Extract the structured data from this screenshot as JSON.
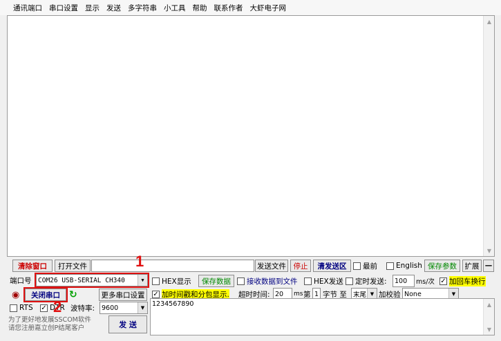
{
  "menu": [
    "通讯端口",
    "串口设置",
    "显示",
    "发送",
    "多字符串",
    "小工具",
    "帮助",
    "联系作者",
    "大虾电子网"
  ],
  "toolbar": {
    "clear_window": "清除窗口",
    "open_file": "打开文件",
    "send_file": "发送文件",
    "stop": "停止",
    "clear_send": "清发送区",
    "topmost": "最前",
    "english": "English",
    "save_params": "保存参数",
    "expand": "扩展",
    "collapse": "—"
  },
  "port": {
    "label": "端口号",
    "value": "COM26 USB-SERIAL CH340",
    "close_port": "关闭串口",
    "more_settings": "更多串口设置",
    "rts": "RTS",
    "dtr": "DTR",
    "baud_label": "波特率:",
    "baud_value": "9600"
  },
  "options": {
    "hex_display": "HEX显示",
    "save_data": "保存数据",
    "receive_to_file": "接收数据到文件",
    "hex_send": "HEX发送",
    "timed_send": "定时发送:",
    "interval": "100",
    "interval_unit": "ms/次",
    "add_newline": "加回车换行",
    "timestamp": "加时间戳和分包显示.",
    "timeout_label": "超时时间:",
    "timeout_value": "20",
    "timeout_unit": "ms",
    "byte_prefix": "第",
    "byte_index": "1",
    "byte_unit": "字节 至",
    "byte_end": "末尾",
    "checksum_label": "加校验",
    "checksum_value": "None"
  },
  "send": {
    "text": "1234567890",
    "button": "发 送"
  },
  "footer": {
    "line1": "为了更好地发展SSCOM软件",
    "line2": "请您注册嘉立创P结尾客户"
  },
  "annotations": {
    "num1": "1",
    "num2": "2"
  },
  "colors": {
    "annotation": "#e01010",
    "highlight": "#ffff00",
    "stop": "#cc0000"
  }
}
